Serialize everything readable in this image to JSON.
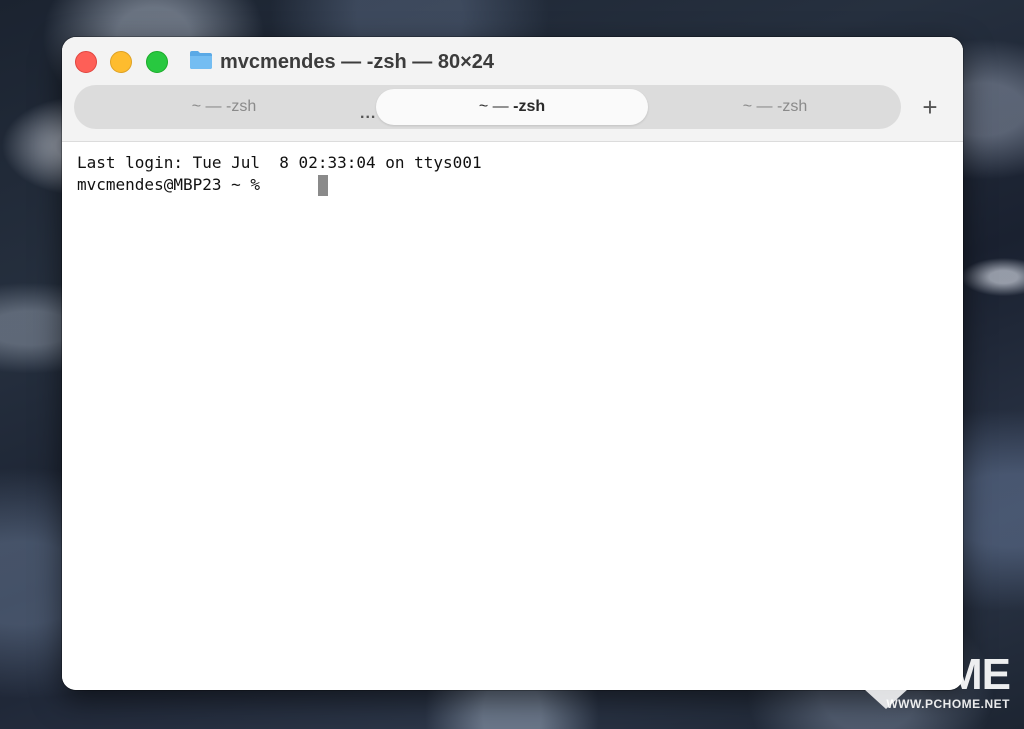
{
  "window": {
    "title": "mvcmendes — -zsh — 80×24",
    "traffic_lights": {
      "close": "#fe5f57",
      "minimize": "#febc2e",
      "zoom": "#28c840"
    }
  },
  "tabs": [
    {
      "prefix": "~ — ",
      "name": "-zsh",
      "active": false
    },
    {
      "prefix": "~ — ",
      "name": "-zsh",
      "active": true
    },
    {
      "prefix": "~ — ",
      "name": "-zsh",
      "active": false
    }
  ],
  "tab_overflow": "...",
  "add_tab": "+",
  "terminal": {
    "lines": [
      "Last login: Tue Jul  8 02:33:04 on ttys001",
      "mvcmendes@MBP23 ~ %"
    ]
  },
  "watermark": {
    "big": "ME",
    "small": "WWW.PCHOME.NET"
  }
}
